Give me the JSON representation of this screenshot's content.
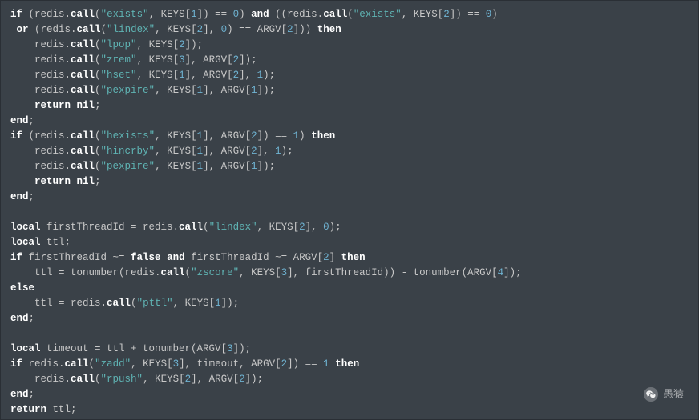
{
  "code": {
    "lines": [
      {
        "tokens": [
          {
            "t": "kw",
            "v": "if"
          },
          {
            "t": "p",
            "v": " (redis."
          },
          {
            "t": "fn",
            "v": "call"
          },
          {
            "t": "p",
            "v": "("
          },
          {
            "t": "str",
            "v": "\"exists\""
          },
          {
            "t": "p",
            "v": ", KEYS["
          },
          {
            "t": "num",
            "v": "1"
          },
          {
            "t": "p",
            "v": "]) == "
          },
          {
            "t": "num",
            "v": "0"
          },
          {
            "t": "p",
            "v": ") "
          },
          {
            "t": "kw",
            "v": "and"
          },
          {
            "t": "p",
            "v": " ((redis."
          },
          {
            "t": "fn",
            "v": "call"
          },
          {
            "t": "p",
            "v": "("
          },
          {
            "t": "str",
            "v": "\"exists\""
          },
          {
            "t": "p",
            "v": ", KEYS["
          },
          {
            "t": "num",
            "v": "2"
          },
          {
            "t": "p",
            "v": "]) == "
          },
          {
            "t": "num",
            "v": "0"
          },
          {
            "t": "p",
            "v": ")"
          }
        ]
      },
      {
        "tokens": [
          {
            "t": "p",
            "v": " "
          },
          {
            "t": "kw",
            "v": "or"
          },
          {
            "t": "p",
            "v": " (redis."
          },
          {
            "t": "fn",
            "v": "call"
          },
          {
            "t": "p",
            "v": "("
          },
          {
            "t": "str",
            "v": "\"lindex\""
          },
          {
            "t": "p",
            "v": ", KEYS["
          },
          {
            "t": "num",
            "v": "2"
          },
          {
            "t": "p",
            "v": "], "
          },
          {
            "t": "num",
            "v": "0"
          },
          {
            "t": "p",
            "v": ") == ARGV["
          },
          {
            "t": "num",
            "v": "2"
          },
          {
            "t": "p",
            "v": "])) "
          },
          {
            "t": "kw",
            "v": "then"
          }
        ]
      },
      {
        "tokens": [
          {
            "t": "p",
            "v": "    redis."
          },
          {
            "t": "fn",
            "v": "call"
          },
          {
            "t": "p",
            "v": "("
          },
          {
            "t": "str",
            "v": "\"lpop\""
          },
          {
            "t": "p",
            "v": ", KEYS["
          },
          {
            "t": "num",
            "v": "2"
          },
          {
            "t": "p",
            "v": "]);"
          }
        ]
      },
      {
        "tokens": [
          {
            "t": "p",
            "v": "    redis."
          },
          {
            "t": "fn",
            "v": "call"
          },
          {
            "t": "p",
            "v": "("
          },
          {
            "t": "str",
            "v": "\"zrem\""
          },
          {
            "t": "p",
            "v": ", KEYS["
          },
          {
            "t": "num",
            "v": "3"
          },
          {
            "t": "p",
            "v": "], ARGV["
          },
          {
            "t": "num",
            "v": "2"
          },
          {
            "t": "p",
            "v": "]);"
          }
        ]
      },
      {
        "tokens": [
          {
            "t": "p",
            "v": "    redis."
          },
          {
            "t": "fn",
            "v": "call"
          },
          {
            "t": "p",
            "v": "("
          },
          {
            "t": "str",
            "v": "\"hset\""
          },
          {
            "t": "p",
            "v": ", KEYS["
          },
          {
            "t": "num",
            "v": "1"
          },
          {
            "t": "p",
            "v": "], ARGV["
          },
          {
            "t": "num",
            "v": "2"
          },
          {
            "t": "p",
            "v": "], "
          },
          {
            "t": "num",
            "v": "1"
          },
          {
            "t": "p",
            "v": ");"
          }
        ]
      },
      {
        "tokens": [
          {
            "t": "p",
            "v": "    redis."
          },
          {
            "t": "fn",
            "v": "call"
          },
          {
            "t": "p",
            "v": "("
          },
          {
            "t": "str",
            "v": "\"pexpire\""
          },
          {
            "t": "p",
            "v": ", KEYS["
          },
          {
            "t": "num",
            "v": "1"
          },
          {
            "t": "p",
            "v": "], ARGV["
          },
          {
            "t": "num",
            "v": "1"
          },
          {
            "t": "p",
            "v": "]);"
          }
        ]
      },
      {
        "tokens": [
          {
            "t": "p",
            "v": "    "
          },
          {
            "t": "kw",
            "v": "return"
          },
          {
            "t": "p",
            "v": " "
          },
          {
            "t": "nil",
            "v": "nil"
          },
          {
            "t": "p",
            "v": ";"
          }
        ]
      },
      {
        "tokens": [
          {
            "t": "kw",
            "v": "end"
          },
          {
            "t": "p",
            "v": ";"
          }
        ]
      },
      {
        "tokens": [
          {
            "t": "kw",
            "v": "if"
          },
          {
            "t": "p",
            "v": " (redis."
          },
          {
            "t": "fn",
            "v": "call"
          },
          {
            "t": "p",
            "v": "("
          },
          {
            "t": "str",
            "v": "\"hexists\""
          },
          {
            "t": "p",
            "v": ", KEYS["
          },
          {
            "t": "num",
            "v": "1"
          },
          {
            "t": "p",
            "v": "], ARGV["
          },
          {
            "t": "num",
            "v": "2"
          },
          {
            "t": "p",
            "v": "]) == "
          },
          {
            "t": "num",
            "v": "1"
          },
          {
            "t": "p",
            "v": ") "
          },
          {
            "t": "kw",
            "v": "then"
          }
        ]
      },
      {
        "tokens": [
          {
            "t": "p",
            "v": "    redis."
          },
          {
            "t": "fn",
            "v": "call"
          },
          {
            "t": "p",
            "v": "("
          },
          {
            "t": "str",
            "v": "\"hincrby\""
          },
          {
            "t": "p",
            "v": ", KEYS["
          },
          {
            "t": "num",
            "v": "1"
          },
          {
            "t": "p",
            "v": "], ARGV["
          },
          {
            "t": "num",
            "v": "2"
          },
          {
            "t": "p",
            "v": "], "
          },
          {
            "t": "num",
            "v": "1"
          },
          {
            "t": "p",
            "v": ");"
          }
        ]
      },
      {
        "tokens": [
          {
            "t": "p",
            "v": "    redis."
          },
          {
            "t": "fn",
            "v": "call"
          },
          {
            "t": "p",
            "v": "("
          },
          {
            "t": "str",
            "v": "\"pexpire\""
          },
          {
            "t": "p",
            "v": ", KEYS["
          },
          {
            "t": "num",
            "v": "1"
          },
          {
            "t": "p",
            "v": "], ARGV["
          },
          {
            "t": "num",
            "v": "1"
          },
          {
            "t": "p",
            "v": "]);"
          }
        ]
      },
      {
        "tokens": [
          {
            "t": "p",
            "v": "    "
          },
          {
            "t": "kw",
            "v": "return"
          },
          {
            "t": "p",
            "v": " "
          },
          {
            "t": "nil",
            "v": "nil"
          },
          {
            "t": "p",
            "v": ";"
          }
        ]
      },
      {
        "tokens": [
          {
            "t": "kw",
            "v": "end"
          },
          {
            "t": "p",
            "v": ";"
          }
        ]
      },
      {
        "tokens": []
      },
      {
        "tokens": [
          {
            "t": "kw",
            "v": "local"
          },
          {
            "t": "p",
            "v": " firstThreadId = redis."
          },
          {
            "t": "fn",
            "v": "call"
          },
          {
            "t": "p",
            "v": "("
          },
          {
            "t": "str",
            "v": "\"lindex\""
          },
          {
            "t": "p",
            "v": ", KEYS["
          },
          {
            "t": "num",
            "v": "2"
          },
          {
            "t": "p",
            "v": "], "
          },
          {
            "t": "num",
            "v": "0"
          },
          {
            "t": "p",
            "v": ");"
          }
        ]
      },
      {
        "tokens": [
          {
            "t": "kw",
            "v": "local"
          },
          {
            "t": "p",
            "v": " ttl;"
          }
        ]
      },
      {
        "tokens": [
          {
            "t": "kw",
            "v": "if"
          },
          {
            "t": "p",
            "v": " firstThreadId ~= "
          },
          {
            "t": "nil",
            "v": "false"
          },
          {
            "t": "p",
            "v": " "
          },
          {
            "t": "kw",
            "v": "and"
          },
          {
            "t": "p",
            "v": " firstThreadId ~= ARGV["
          },
          {
            "t": "num",
            "v": "2"
          },
          {
            "t": "p",
            "v": "] "
          },
          {
            "t": "kw",
            "v": "then"
          }
        ]
      },
      {
        "tokens": [
          {
            "t": "p",
            "v": "    ttl = tonumber(redis."
          },
          {
            "t": "fn",
            "v": "call"
          },
          {
            "t": "p",
            "v": "("
          },
          {
            "t": "str",
            "v": "\"zscore\""
          },
          {
            "t": "p",
            "v": ", KEYS["
          },
          {
            "t": "num",
            "v": "3"
          },
          {
            "t": "p",
            "v": "], firstThreadId)) - tonumber(ARGV["
          },
          {
            "t": "num",
            "v": "4"
          },
          {
            "t": "p",
            "v": "]);"
          }
        ]
      },
      {
        "tokens": [
          {
            "t": "kw",
            "v": "else"
          }
        ]
      },
      {
        "tokens": [
          {
            "t": "p",
            "v": "    ttl = redis."
          },
          {
            "t": "fn",
            "v": "call"
          },
          {
            "t": "p",
            "v": "("
          },
          {
            "t": "str",
            "v": "\"pttl\""
          },
          {
            "t": "p",
            "v": ", KEYS["
          },
          {
            "t": "num",
            "v": "1"
          },
          {
            "t": "p",
            "v": "]);"
          }
        ]
      },
      {
        "tokens": [
          {
            "t": "kw",
            "v": "end"
          },
          {
            "t": "p",
            "v": ";"
          }
        ]
      },
      {
        "tokens": []
      },
      {
        "tokens": [
          {
            "t": "kw",
            "v": "local"
          },
          {
            "t": "p",
            "v": " timeout = ttl + tonumber(ARGV["
          },
          {
            "t": "num",
            "v": "3"
          },
          {
            "t": "p",
            "v": "]);"
          }
        ]
      },
      {
        "tokens": [
          {
            "t": "kw",
            "v": "if"
          },
          {
            "t": "p",
            "v": " redis."
          },
          {
            "t": "fn",
            "v": "call"
          },
          {
            "t": "p",
            "v": "("
          },
          {
            "t": "str",
            "v": "\"zadd\""
          },
          {
            "t": "p",
            "v": ", KEYS["
          },
          {
            "t": "num",
            "v": "3"
          },
          {
            "t": "p",
            "v": "], timeout, ARGV["
          },
          {
            "t": "num",
            "v": "2"
          },
          {
            "t": "p",
            "v": "]) == "
          },
          {
            "t": "num",
            "v": "1"
          },
          {
            "t": "p",
            "v": " "
          },
          {
            "t": "kw",
            "v": "then"
          }
        ]
      },
      {
        "tokens": [
          {
            "t": "p",
            "v": "    redis."
          },
          {
            "t": "fn",
            "v": "call"
          },
          {
            "t": "p",
            "v": "("
          },
          {
            "t": "str",
            "v": "\"rpush\""
          },
          {
            "t": "p",
            "v": ", KEYS["
          },
          {
            "t": "num",
            "v": "2"
          },
          {
            "t": "p",
            "v": "], ARGV["
          },
          {
            "t": "num",
            "v": "2"
          },
          {
            "t": "p",
            "v": "]);"
          }
        ]
      },
      {
        "tokens": [
          {
            "t": "kw",
            "v": "end"
          },
          {
            "t": "p",
            "v": ";"
          }
        ]
      },
      {
        "tokens": [
          {
            "t": "kw",
            "v": "return"
          },
          {
            "t": "p",
            "v": " ttl;"
          }
        ]
      }
    ]
  },
  "watermark": {
    "label": "愚猿"
  }
}
